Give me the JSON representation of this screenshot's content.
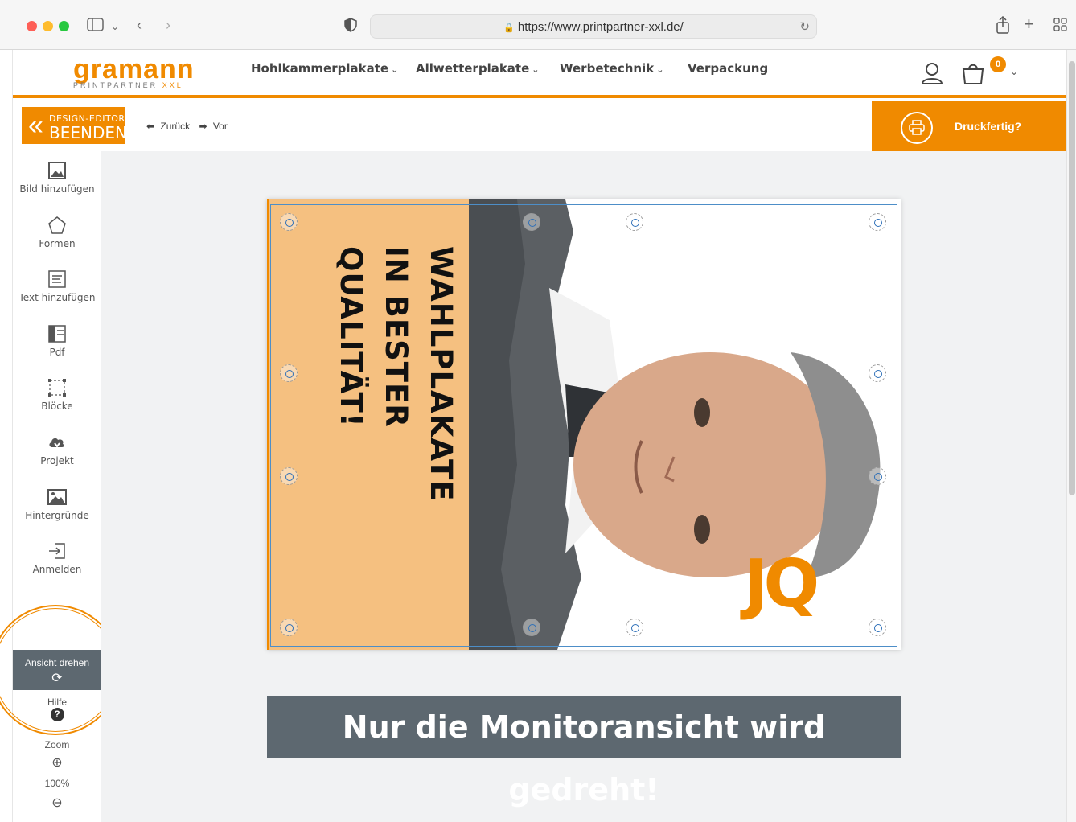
{
  "browser": {
    "url": "https://www.printpartner-xxl.de/"
  },
  "header": {
    "logo_main": "gramann",
    "logo_sub": "PRINTPARTNER",
    "logo_xxl": "XXL",
    "nav": [
      {
        "label": "Hohlkammerplakate",
        "has_dropdown": true
      },
      {
        "label": "Allwetterplakate",
        "has_dropdown": true
      },
      {
        "label": "Werbetechnik",
        "has_dropdown": true
      },
      {
        "label": "Verpackung",
        "has_dropdown": false
      }
    ],
    "cart_count": "0"
  },
  "toolbar": {
    "end_top": "DESIGN-EDITOR",
    "end_bottom": "BEENDEN",
    "undo": "Zurück",
    "redo": "Vor",
    "print_ready": "Druckfertig?"
  },
  "sidebar": {
    "tools": [
      {
        "label": "Bild hinzufügen",
        "icon": "image-add-icon"
      },
      {
        "label": "Formen",
        "icon": "pentagon-icon"
      },
      {
        "label": "Text hinzufügen",
        "icon": "text-add-icon"
      },
      {
        "label": "Pdf",
        "icon": "pdf-icon"
      },
      {
        "label": "Blöcke",
        "icon": "blocks-icon"
      },
      {
        "label": "Projekt",
        "icon": "cloud-download-icon"
      },
      {
        "label": "Hintergründe",
        "icon": "background-image-icon"
      },
      {
        "label": "Anmelden",
        "icon": "login-icon"
      }
    ],
    "rotate_label": "Ansicht drehen",
    "help_label": "Hilfe",
    "zoom_label": "Zoom",
    "zoom_value": "100%"
  },
  "canvas": {
    "headline_line1": "WAHLPLAKATE",
    "headline_line2": "IN BESTER QUALITÄT!",
    "logo_mark": "JQ"
  },
  "banner": {
    "text": "Nur die Monitoransicht wird gedreht!"
  },
  "colors": {
    "accent": "#f08a00",
    "panel_bg": "#f5c080",
    "banner_bg": "#5d6870",
    "guide": "#4d8ec8"
  }
}
